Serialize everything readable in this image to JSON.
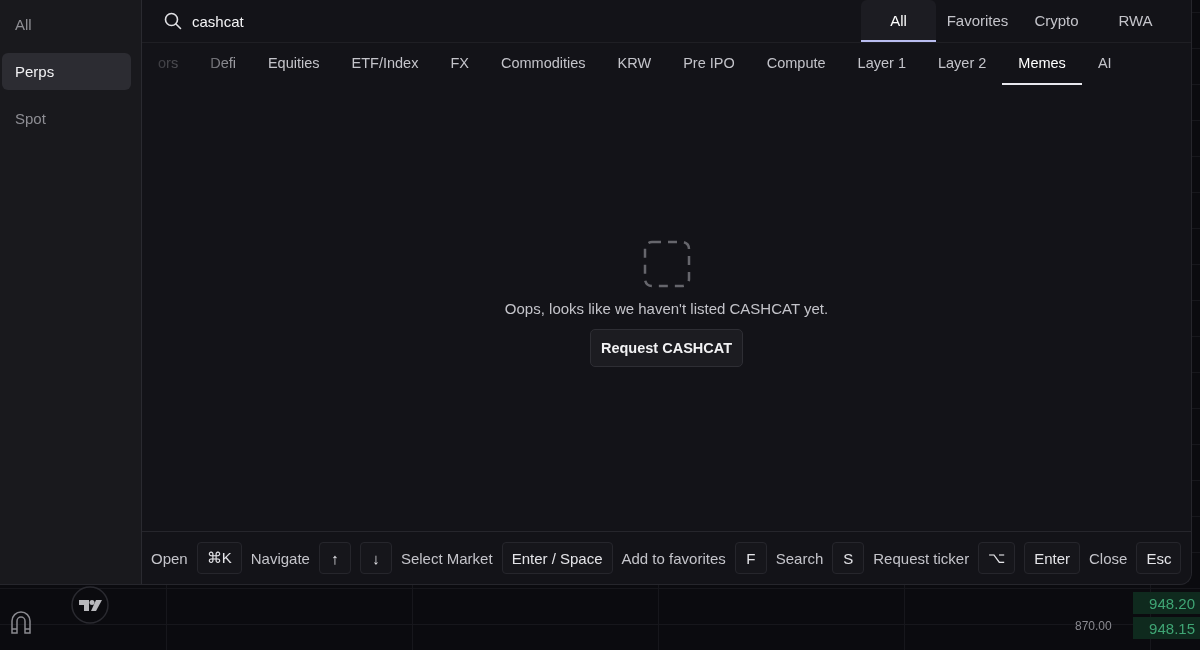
{
  "sidebar": {
    "items": [
      {
        "label": "All",
        "selected": false
      },
      {
        "label": "Perps",
        "selected": true
      },
      {
        "label": "Spot",
        "selected": false
      }
    ]
  },
  "search": {
    "value": "cashcat"
  },
  "market_tabs": [
    {
      "label": "All",
      "selected": true
    },
    {
      "label": "Favorites",
      "selected": false
    },
    {
      "label": "Crypto",
      "selected": false
    },
    {
      "label": "RWA",
      "selected": false
    }
  ],
  "category_tabs": [
    {
      "label": "ors",
      "selected": false
    },
    {
      "label": "Defi",
      "selected": false
    },
    {
      "label": "Equities",
      "selected": false
    },
    {
      "label": "ETF/Index",
      "selected": false
    },
    {
      "label": "FX",
      "selected": false
    },
    {
      "label": "Commodities",
      "selected": false
    },
    {
      "label": "KRW",
      "selected": false
    },
    {
      "label": "Pre IPO",
      "selected": false
    },
    {
      "label": "Compute",
      "selected": false
    },
    {
      "label": "Layer 1",
      "selected": false
    },
    {
      "label": "Layer 2",
      "selected": false
    },
    {
      "label": "Memes",
      "selected": true
    },
    {
      "label": "AI",
      "selected": false
    }
  ],
  "empty_state": {
    "message": "Oops, looks like we haven't listed CASHCAT yet.",
    "button": "Request CASHCAT"
  },
  "shortcuts": [
    {
      "label": "Open",
      "keys": [
        "⌘K"
      ]
    },
    {
      "label": "Navigate",
      "keys": [
        "↑",
        "↓"
      ]
    },
    {
      "label": "Select Market",
      "keys": [
        "Enter / Space"
      ]
    },
    {
      "label": "Add to favorites",
      "keys": [
        "F"
      ]
    },
    {
      "label": "Search",
      "keys": [
        "S"
      ]
    },
    {
      "label": "Request ticker",
      "keys": [
        "⌥",
        "Enter"
      ]
    },
    {
      "label": "Close",
      "keys": [
        "Esc"
      ]
    }
  ],
  "chart": {
    "price_label": "870.00"
  },
  "order_book": [
    {
      "price": "948.20"
    },
    {
      "price": "948.15"
    }
  ]
}
